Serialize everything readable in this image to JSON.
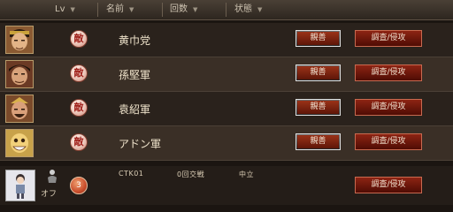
{
  "header": {
    "columns": [
      {
        "label": "Lv"
      },
      {
        "label": "名前"
      },
      {
        "label": "回数"
      },
      {
        "label": "状態"
      }
    ],
    "sort_icon": "triangle-down"
  },
  "rows": [
    {
      "name": "黄巾党",
      "badge": "敵",
      "shin_label": "親善",
      "chosa_label": "調査/侵攻",
      "portrait_icon": "general-portrait-yellow-turban"
    },
    {
      "name": "孫堅軍",
      "badge": "敵",
      "shin_label": "親善",
      "chosa_label": "調査/侵攻",
      "portrait_icon": "general-portrait-sun-jian"
    },
    {
      "name": "袁紹軍",
      "badge": "敵",
      "shin_label": "親善",
      "chosa_label": "調査/侵攻",
      "portrait_icon": "general-portrait-yuan-shao"
    },
    {
      "name": "アドン軍",
      "badge": "敵",
      "shin_label": "親善",
      "chosa_label": "調査/侵攻",
      "portrait_icon": "general-portrait-adon"
    }
  ],
  "player_row": {
    "level": "3",
    "name": "CTK01",
    "count": "0回交戦",
    "status": "中立",
    "off_label": "オフ",
    "chosa_label": "調査/侵攻",
    "portrait_icon": "player-avatar"
  },
  "colors": {
    "accent": "#8d2413",
    "enemy_badge_text": "#a0201a",
    "portrait_border": "#b89b6a"
  }
}
